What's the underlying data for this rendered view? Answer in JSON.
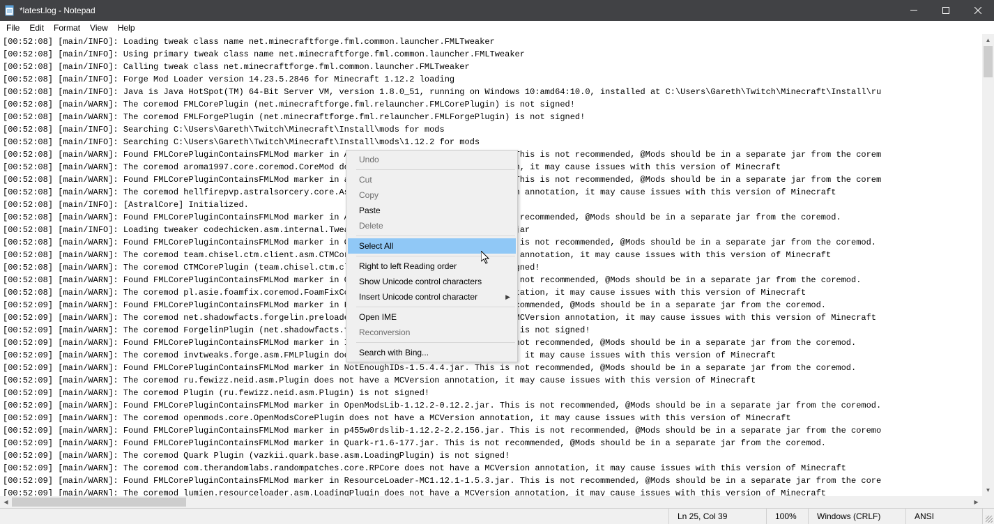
{
  "title": "*latest.log - Notepad",
  "menu": {
    "file": "File",
    "edit": "Edit",
    "format": "Format",
    "view": "View",
    "help": "Help"
  },
  "log_lines": [
    "[00:52:08] [main/INFO]: Loading tweak class name net.minecraftforge.fml.common.launcher.FMLTweaker",
    "[00:52:08] [main/INFO]: Using primary tweak class name net.minecraftforge.fml.common.launcher.FMLTweaker",
    "[00:52:08] [main/INFO]: Calling tweak class net.minecraftforge.fml.common.launcher.FMLTweaker",
    "[00:52:08] [main/INFO]: Forge Mod Loader version 14.23.5.2846 for Minecraft 1.12.2 loading",
    "[00:52:08] [main/INFO]: Java is Java HotSpot(TM) 64-Bit Server VM, version 1.8.0_51, running on Windows 10:amd64:10.0, installed at C:\\Users\\Gareth\\Twitch\\Minecraft\\Install\\ru",
    "[00:52:08] [main/WARN]: The coremod FMLCorePlugin (net.minecraftforge.fml.relauncher.FMLCorePlugin) is not signed!",
    "[00:52:08] [main/WARN]: The coremod FMLForgePlugin (net.minecraftforge.fml.relauncher.FMLForgePlugin) is not signed!",
    "[00:52:08] [main/INFO]: Searching C:\\Users\\Gareth\\Twitch\\Minecraft\\Install\\mods for mods",
    "[00:52:08] [main/INFO]: Searching C:\\Users\\Gareth\\Twitch\\Minecraft\\Install\\mods\\1.12.2 for mods",
    "[00:52:08] [main/WARN]: Found FMLCorePluginContainsFMLMod marker in Aroma1997Core-1.12.2-2.0.0.2.jar. This is not recommended, @Mods should be in a separate jar from the corem",
    "[00:52:08] [main/WARN]: The coremod aroma1997.core.coremod.CoreMod does not have a MCVersion annotation, it may cause issues with this version of Minecraft",
    "[00:52:08] [main/WARN]: Found FMLCorePluginContainsFMLMod marker in astralsorcery-1.12.2-1.10.20.jar. This is not recommended, @Mods should be in a separate jar from the corem",
    "[00:52:08] [main/WARN]: The coremod hellfirepvp.astralsorcery.core.AstralCore does not have a MCVersion annotation, it may cause issues with this version of Minecraft",
    "[00:52:08] [main/INFO]: [AstralCore] Initialized.",
    "[00:52:08] [main/WARN]: Found FMLCorePluginContainsFMLMod marker in AutoRegLib-1.3-32.jar. This is not recommended, @Mods should be in a separate jar from the coremod.",
    "[00:52:08] [main/INFO]: Loading tweaker codechicken.asm.internal.Tweaker from ChickenASM-1.12-1.0.2.7.jar",
    "[00:52:08] [main/WARN]: Found FMLCorePluginContainsFMLMod marker in Chisel-MC1.12.2-1.0.1.44.jar. This is not recommended, @Mods should be in a separate jar from the coremod.",
    "[00:52:08] [main/WARN]: The coremod team.chisel.ctm.client.asm.CTMCorePlugin does not have a MCVersion annotation, it may cause issues with this version of Minecraft",
    "[00:52:08] [main/WARN]: The coremod CTMCorePlugin (team.chisel.ctm.client.asm.CTMCorePlugin) is not signed!",
    "[00:52:08] [main/WARN]: Found FMLCorePluginContainsFMLMod marker in CTM-MC1.12.2-1.0.0.29.jar. This is not recommended, @Mods should be in a separate jar from the coremod.",
    "[00:52:08] [main/WARN]: The coremod pl.asie.foamfix.coremod.FoamFixCore does not have a MCVersion annotation, it may cause issues with this version of Minecraft",
    "[00:52:09] [main/WARN]: Found FMLCorePluginContainsFMLMod marker in Forgelin-1.8.4.jar. This is not recommended, @Mods should be in a separate jar from the coremod.",
    "[00:52:09] [main/WARN]: The coremod net.shadowfacts.forgelin.preloader.ForgelinPlugin does not have a MCVersion annotation, it may cause issues with this version of Minecraft",
    "[00:52:09] [main/WARN]: The coremod ForgelinPlugin (net.shadowfacts.forgelin.preloader.ForgelinPlugin) is not signed!",
    "[00:52:09] [main/WARN]: Found FMLCorePluginContainsFMLMod marker in InventoryTweaks-1.63.jar. This is not recommended, @Mods should be in a separate jar from the coremod.",
    "[00:52:09] [main/WARN]: The coremod invtweaks.forge.asm.FMLPlugin does not have a MCVersion annotation, it may cause issues with this version of Minecraft",
    "[00:52:09] [main/WARN]: Found FMLCorePluginContainsFMLMod marker in NotEnoughIDs-1.5.4.4.jar. This is not recommended, @Mods should be in a separate jar from the coremod.",
    "[00:52:09] [main/WARN]: The coremod ru.fewizz.neid.asm.Plugin does not have a MCVersion annotation, it may cause issues with this version of Minecraft",
    "[00:52:09] [main/WARN]: The coremod Plugin (ru.fewizz.neid.asm.Plugin) is not signed!",
    "[00:52:09] [main/WARN]: Found FMLCorePluginContainsFMLMod marker in OpenModsLib-1.12.2-0.12.2.jar. This is not recommended, @Mods should be in a separate jar from the coremod.",
    "[00:52:09] [main/WARN]: The coremod openmods.core.OpenModsCorePlugin does not have a MCVersion annotation, it may cause issues with this version of Minecraft",
    "[00:52:09] [main/WARN]: Found FMLCorePluginContainsFMLMod marker in p455w0rdslib-1.12.2-2.2.156.jar. This is not recommended, @Mods should be in a separate jar from the coremo",
    "[00:52:09] [main/WARN]: Found FMLCorePluginContainsFMLMod marker in Quark-r1.6-177.jar. This is not recommended, @Mods should be in a separate jar from the coremod.",
    "[00:52:09] [main/WARN]: The coremod Quark Plugin (vazkii.quark.base.asm.LoadingPlugin) is not signed!",
    "[00:52:09] [main/WARN]: The coremod com.therandomlabs.randompatches.core.RPCore does not have a MCVersion annotation, it may cause issues with this version of Minecraft",
    "[00:52:09] [main/WARN]: Found FMLCorePluginContainsFMLMod marker in ResourceLoader-MC1.12.1-1.5.3.jar. This is not recommended, @Mods should be in a separate jar from the core",
    "[00:52:09] [main/WARN]: The coremod lumien.resourceloader.asm.LoadingPlugin does not have a MCVersion annotation, it may cause issues with this version of Minecraft"
  ],
  "context_menu": {
    "undo": "Undo",
    "cut": "Cut",
    "copy": "Copy",
    "paste": "Paste",
    "delete": "Delete",
    "select_all": "Select All",
    "rtl": "Right to left Reading order",
    "show_unicode": "Show Unicode control characters",
    "insert_unicode": "Insert Unicode control character",
    "open_ime": "Open IME",
    "reconversion": "Reconversion",
    "search_bing": "Search with Bing..."
  },
  "status": {
    "pos": "Ln 25, Col 39",
    "zoom": "100%",
    "eol": "Windows (CRLF)",
    "encoding": "ANSI"
  }
}
